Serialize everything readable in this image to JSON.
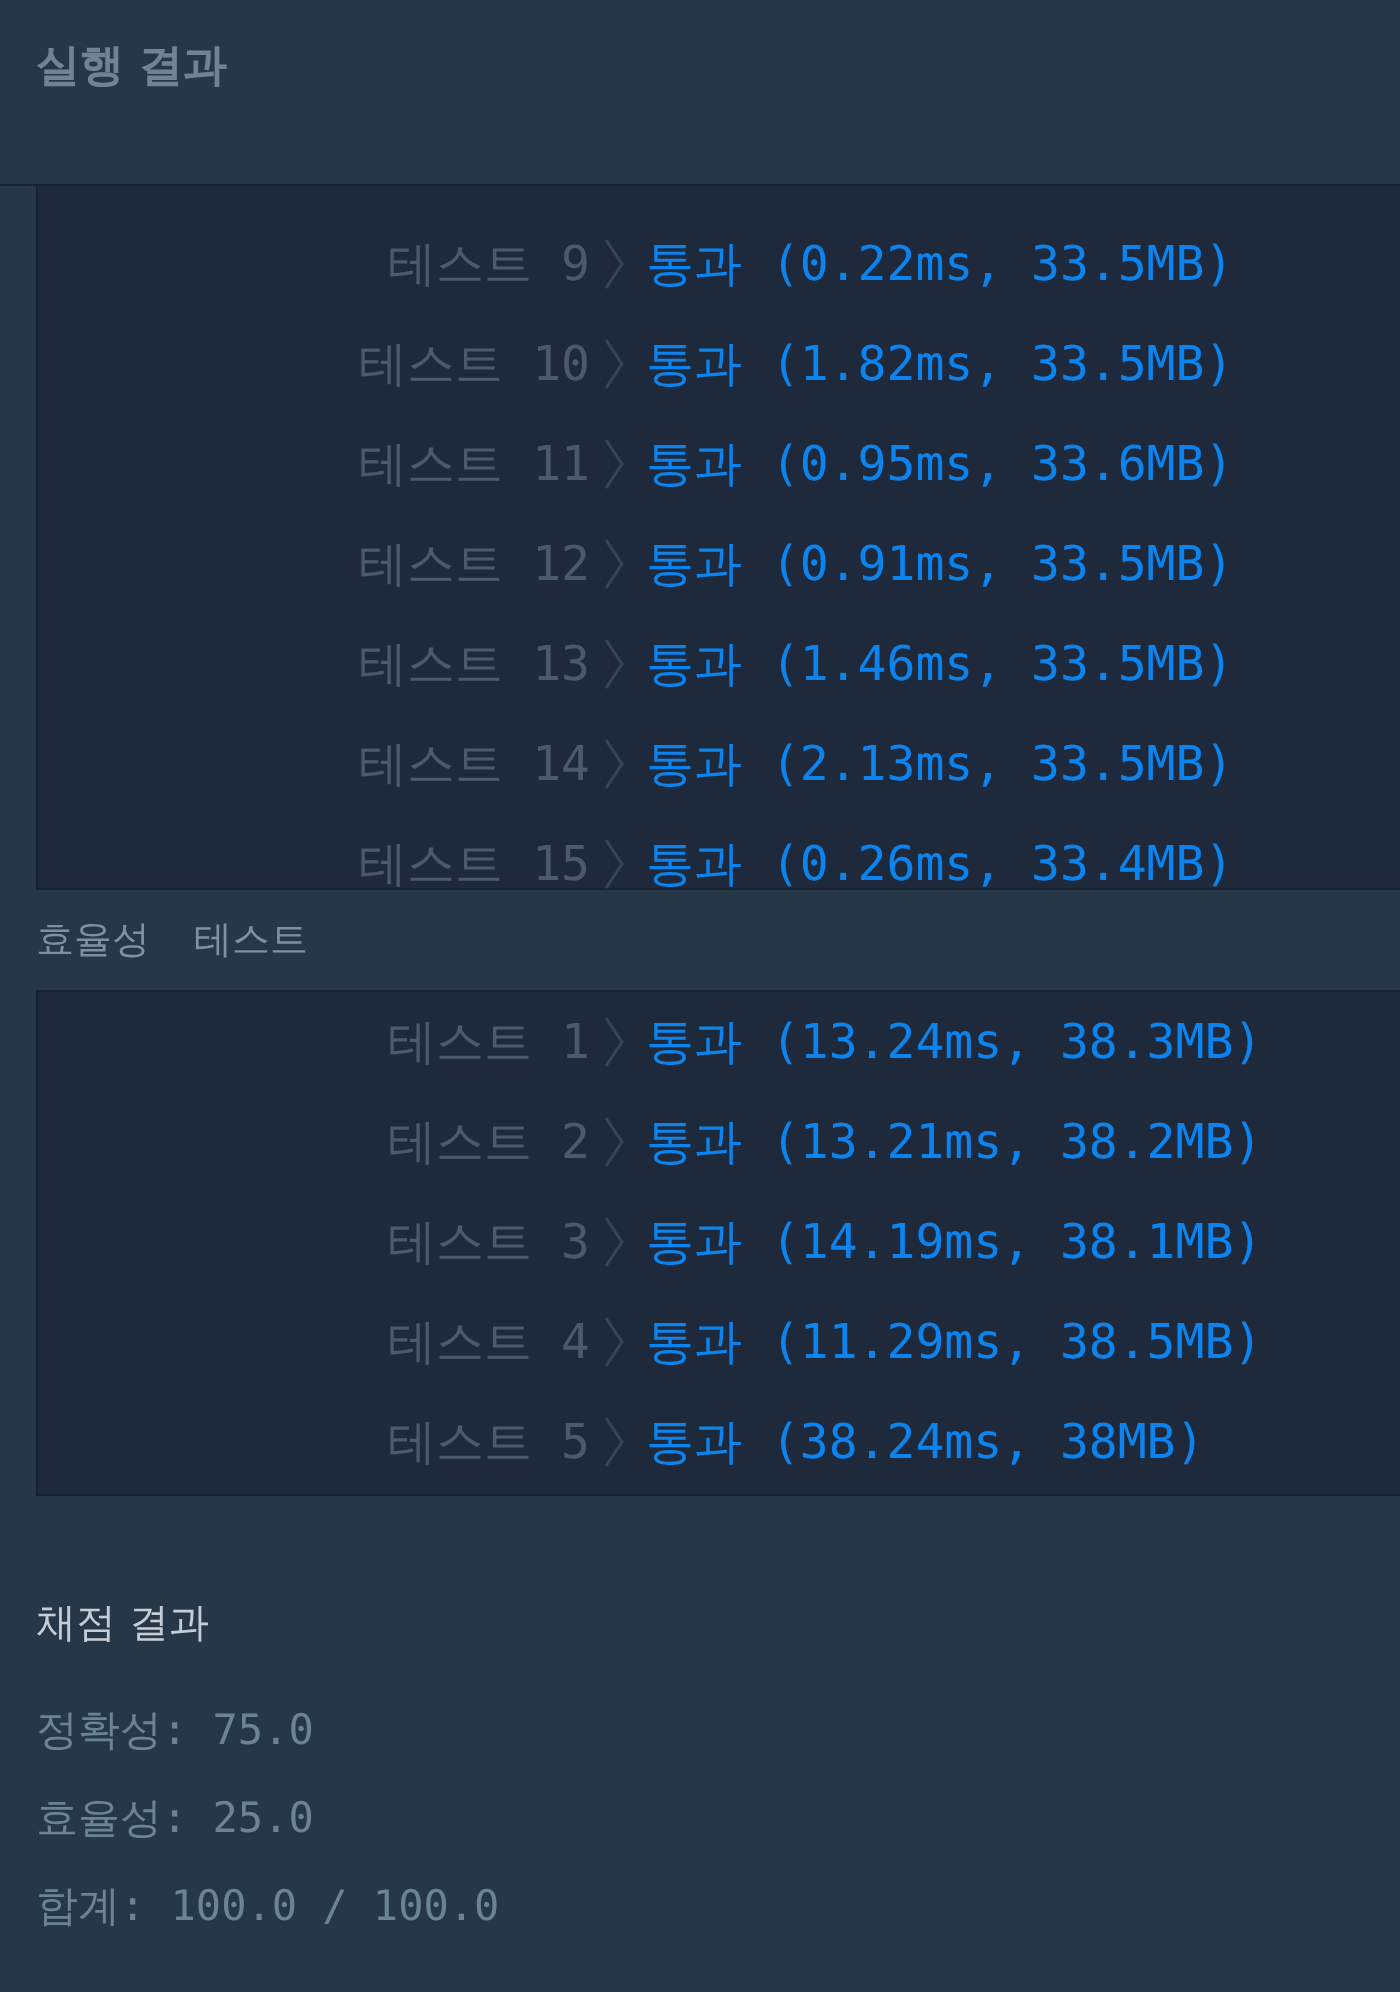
{
  "header": {
    "title": "실행 결과"
  },
  "correctness_tests": [
    {
      "label": "테스트 9",
      "result": "통과 (0.22ms, 33.5MB)"
    },
    {
      "label": "테스트 10",
      "result": "통과 (1.82ms, 33.5MB)"
    },
    {
      "label": "테스트 11",
      "result": "통과 (0.95ms, 33.6MB)"
    },
    {
      "label": "테스트 12",
      "result": "통과 (0.91ms, 33.5MB)"
    },
    {
      "label": "테스트 13",
      "result": "통과 (1.46ms, 33.5MB)"
    },
    {
      "label": "테스트 14",
      "result": "통과 (2.13ms, 33.5MB)"
    },
    {
      "label": "테스트 15",
      "result": "통과 (0.26ms, 33.4MB)"
    }
  ],
  "efficiency_title": "효율성 테스트",
  "efficiency_tests": [
    {
      "label": "테스트 1",
      "result": "통과 (13.24ms, 38.3MB)"
    },
    {
      "label": "테스트 2",
      "result": "통과 (13.21ms, 38.2MB)"
    },
    {
      "label": "테스트 3",
      "result": "통과 (14.19ms, 38.1MB)"
    },
    {
      "label": "테스트 4",
      "result": "통과 (11.29ms, 38.5MB)"
    },
    {
      "label": "테스트 5",
      "result": "통과 (38.24ms, 38MB)"
    }
  ],
  "grading": {
    "title": "채점 결과",
    "lines": [
      "정확성: 75.0",
      "효율성: 25.0",
      "합계: 100.0 / 100.0"
    ]
  }
}
